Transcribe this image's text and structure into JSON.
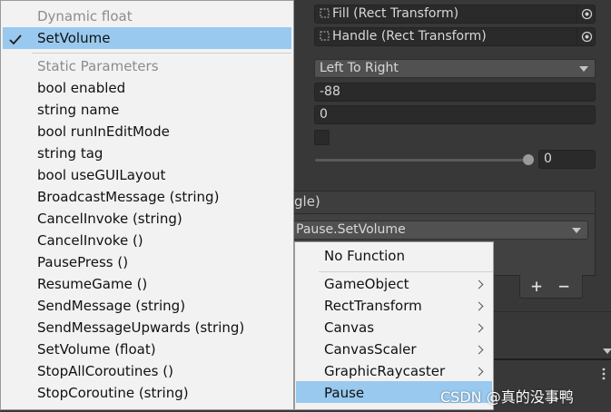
{
  "inspector": {
    "fill_rect": "Fill (Rect Transform)",
    "handle_rect": "Handle (Rect Transform)",
    "direction": "Left To Right",
    "min_value": "-88",
    "max_value": "0",
    "slider_value": "0",
    "event_header_fragment": "gle)",
    "function_selected": "Pause.SetVolume",
    "plus_label": "+",
    "minus_label": "−"
  },
  "menu": {
    "dynamic_header": "Dynamic float",
    "dynamic_items": [
      "SetVolume"
    ],
    "static_header": "Static Parameters",
    "static_items": [
      "bool enabled",
      "string name",
      "bool runInEditMode",
      "string tag",
      "bool useGUILayout",
      "BroadcastMessage (string)",
      "CancelInvoke (string)",
      "CancelInvoke ()",
      "PausePress ()",
      "ResumeGame ()",
      "SendMessage (string)",
      "SendMessageUpwards (string)",
      "SetVolume (float)",
      "StopAllCoroutines ()",
      "StopCoroutine (string)"
    ]
  },
  "submenu": {
    "no_function": "No Function",
    "items": [
      "GameObject",
      "RectTransform",
      "Canvas",
      "CanvasScaler",
      "GraphicRaycaster",
      "Pause"
    ]
  },
  "watermark": "CSDN @真的没事鸭",
  "colors": {
    "menu_bg": "#f2f2f2",
    "highlight": "#99c9ef",
    "panel_bg": "#383838",
    "field_bg": "#2a2a2a"
  }
}
